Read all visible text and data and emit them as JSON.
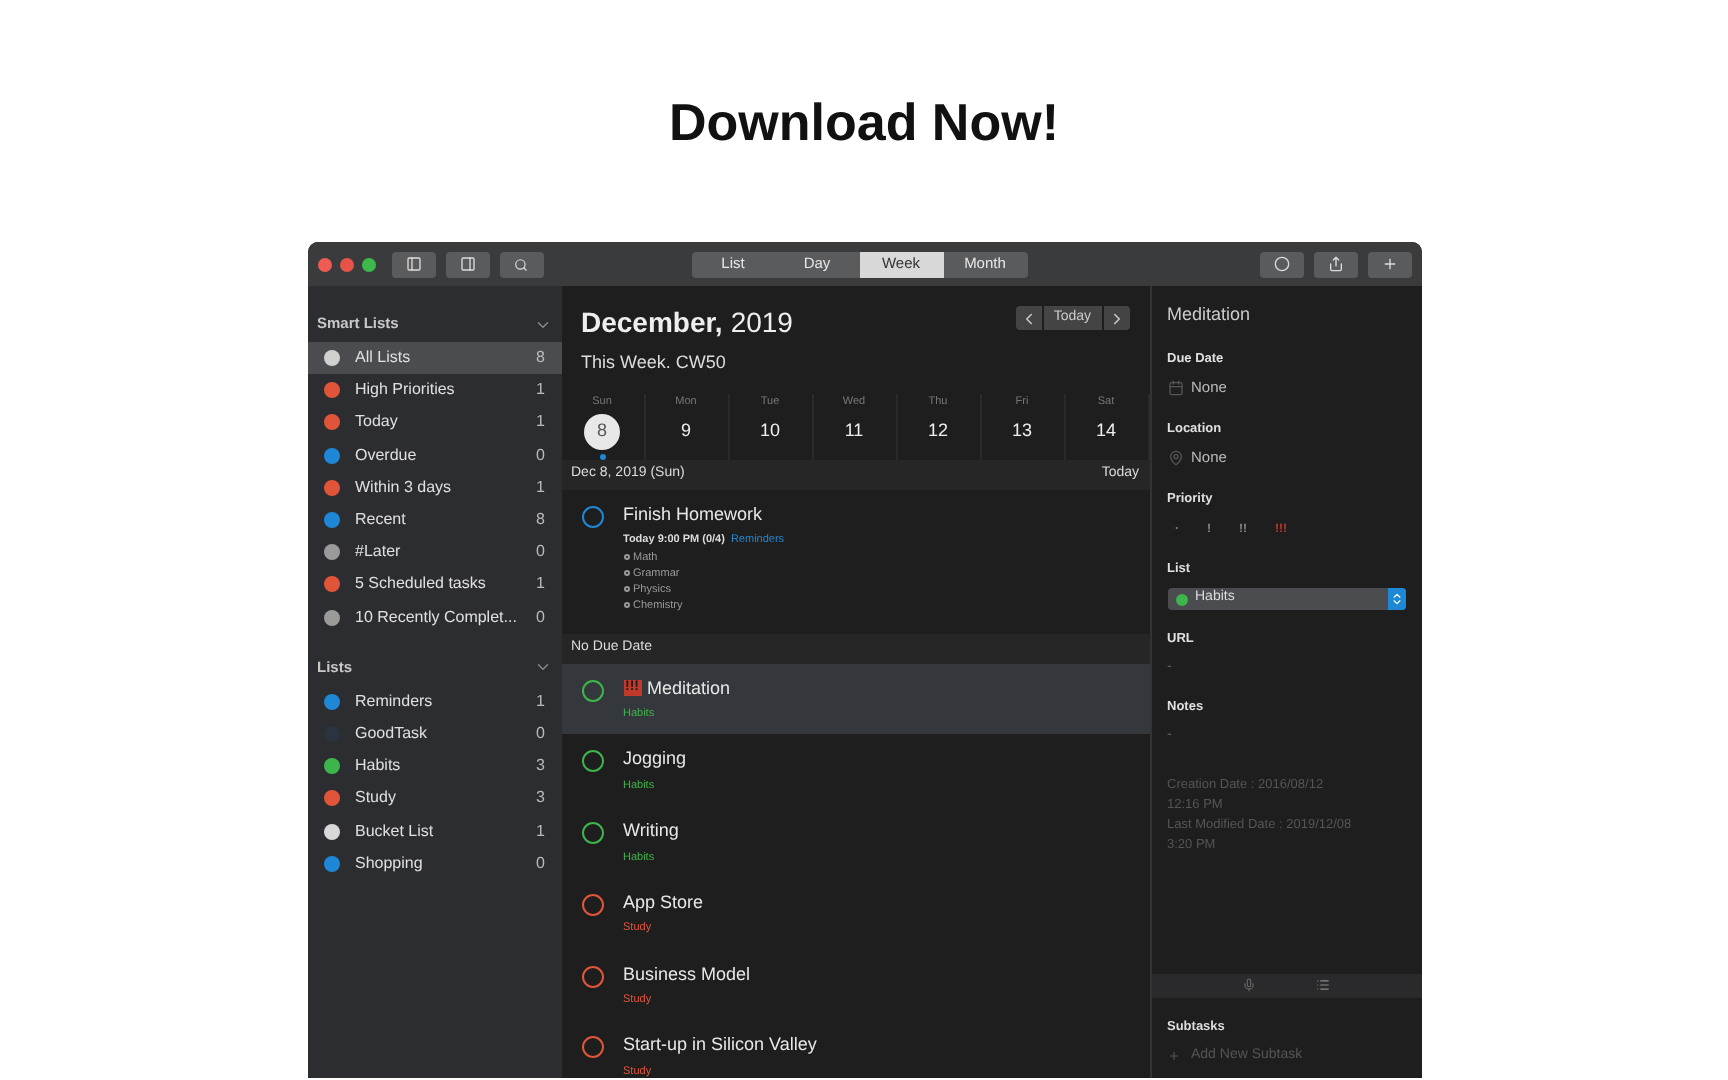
{
  "headline": "Download Now!",
  "toolbar": {
    "views": [
      {
        "label": "List",
        "selected": false
      },
      {
        "label": "Day",
        "selected": false
      },
      {
        "label": "Week",
        "selected": true
      },
      {
        "label": "Month",
        "selected": false
      }
    ]
  },
  "sidebar": {
    "sections": [
      {
        "title": "Smart Lists",
        "items": [
          {
            "label": "All Lists",
            "count": "8",
            "color": "#d0d0d0",
            "selected": true
          },
          {
            "label": "High Priorities",
            "count": "1",
            "color": "#e0553a",
            "selected": false
          },
          {
            "label": "Today",
            "count": "1",
            "color": "#e0553a",
            "selected": false
          },
          {
            "label": "Overdue",
            "count": "0",
            "color": "#1e88d6",
            "selected": false
          },
          {
            "label": "Within 3 days",
            "count": "1",
            "color": "#e0553a",
            "selected": false
          },
          {
            "label": "Recent",
            "count": "8",
            "color": "#1e88d6",
            "selected": false
          },
          {
            "label": "#Later",
            "count": "0",
            "color": "#9a9a9a",
            "selected": false
          },
          {
            "label": "5 Scheduled tasks",
            "count": "1",
            "color": "#e0553a",
            "selected": false
          },
          {
            "label": "10 Recently Complet...",
            "count": "0",
            "color": "#9a9a9a",
            "selected": false
          }
        ]
      },
      {
        "title": "Lists",
        "items": [
          {
            "label": "Reminders",
            "count": "1",
            "color": "#1e88d6",
            "selected": false
          },
          {
            "label": "GoodTask",
            "count": "0",
            "color": "#2a3440",
            "selected": false
          },
          {
            "label": "Habits",
            "count": "3",
            "color": "#3db54a",
            "selected": false
          },
          {
            "label": "Study",
            "count": "3",
            "color": "#e0553a",
            "selected": false
          },
          {
            "label": "Bucket List",
            "count": "1",
            "color": "#d8d8d8",
            "selected": false
          },
          {
            "label": "Shopping",
            "count": "0",
            "color": "#1e88d6",
            "selected": false
          }
        ]
      }
    ]
  },
  "calendar": {
    "month": "December,",
    "year": "2019",
    "subtitle": "This Week. CW50",
    "today_button": "Today",
    "days": [
      {
        "weekday": "Sun",
        "date": "8",
        "selected": true
      },
      {
        "weekday": "Mon",
        "date": "9",
        "selected": false
      },
      {
        "weekday": "Tue",
        "date": "10",
        "selected": false
      },
      {
        "weekday": "Wed",
        "date": "11",
        "selected": false
      },
      {
        "weekday": "Thu",
        "date": "12",
        "selected": false
      },
      {
        "weekday": "Fri",
        "date": "13",
        "selected": false
      },
      {
        "weekday": "Sat",
        "date": "14",
        "selected": false
      }
    ]
  },
  "groups": [
    {
      "title": "Dec 8, 2019 (Sun)",
      "trailing": "Today",
      "tasks": [
        {
          "title": "Finish Homework",
          "due": "Today 9:00 PM (0/4)",
          "list": "Reminders",
          "color": "#1e88d6",
          "selected": false,
          "subtasks": [
            "Math",
            "Grammar",
            "Physics",
            "Chemistry"
          ]
        }
      ]
    },
    {
      "title": "No Due Date",
      "tasks": [
        {
          "priority": "!!!",
          "title": "Meditation",
          "list": "Habits",
          "color": "#3db54a",
          "selected": true
        },
        {
          "title": "Jogging",
          "list": "Habits",
          "color": "#3db54a",
          "selected": false
        },
        {
          "title": "Writing",
          "list": "Habits",
          "color": "#3db54a",
          "selected": false
        },
        {
          "title": "App Store",
          "list": "Study",
          "color": "#e0553a",
          "selected": false
        },
        {
          "title": "Business Model",
          "list": "Study",
          "color": "#e0553a",
          "selected": false
        },
        {
          "title": "Start-up in Silicon Valley",
          "list": "Study",
          "color": "#e0553a",
          "selected": false
        }
      ]
    }
  ],
  "detail": {
    "title": "Meditation",
    "due_label": "Due Date",
    "due_value": "None",
    "location_label": "Location",
    "location_value": "None",
    "priority_label": "Priority",
    "priorities": [
      {
        "label": "·",
        "selected": false
      },
      {
        "label": "!",
        "selected": false
      },
      {
        "label": "!!",
        "selected": false
      },
      {
        "label": "!!!",
        "selected": true
      }
    ],
    "list_label": "List",
    "list": {
      "value": "Habits",
      "color": "#3db54a"
    },
    "url_label": "URL",
    "url_value": "-",
    "notes_label": "Notes",
    "notes_value": "-",
    "meta": [
      "Creation Date : 2016/08/12",
      "12:16 PM",
      "Last Modified Date : 2019/12/08",
      "3:20 PM"
    ],
    "subtasks_label": "Subtasks",
    "subtask_placeholder": "Add New Subtask"
  }
}
